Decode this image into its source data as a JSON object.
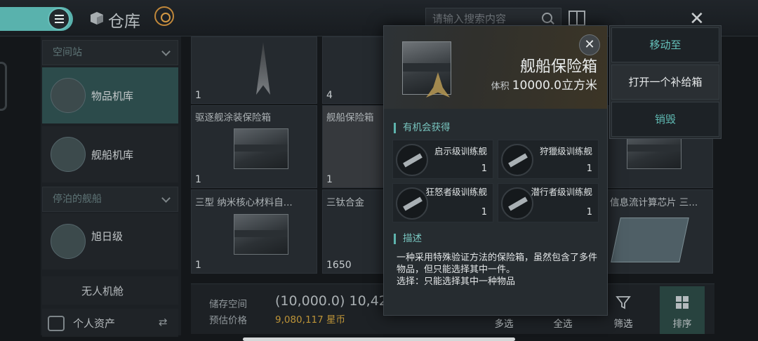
{
  "header": {
    "title": "仓库",
    "search_placeholder": "请输入搜索内容"
  },
  "sidebar": {
    "station_dropdown": "空间站",
    "items": [
      {
        "label": "物品机库"
      },
      {
        "label": "舰船机库"
      }
    ],
    "docked_dropdown": "停泊的舰船",
    "ship": {
      "label": "旭日级"
    },
    "drone_bay": "无人机舱",
    "personal_assets": "个人资产"
  },
  "grid": {
    "cells": [
      {
        "count": "1"
      },
      {
        "count": "4"
      },
      {
        "name": "驱逐舰涂装保险箱",
        "count": "1"
      },
      {
        "name": "舰船保险箱",
        "count": "1"
      },
      {
        "count": ""
      },
      {
        "name": "信息流计算芯片 三...",
        "count": ""
      },
      {
        "name": "三型 纳米核心材料自...",
        "count": "1"
      },
      {
        "name": "三钛合金",
        "count": "1650"
      }
    ]
  },
  "footer": {
    "storage_label": "储存空间",
    "storage_value": "(10,000.0) 10,42",
    "price_label": "预估价格",
    "price_value": "9,080,117 星币",
    "actions": [
      "多选",
      "全选",
      "筛选",
      "排序"
    ]
  },
  "popup": {
    "title": "舰船保险箱",
    "volume_label": "体积",
    "volume_value": "10000.0立方米",
    "chance_section": "有机会获得",
    "loot": [
      {
        "name": "启示级训练舰",
        "qty": "1"
      },
      {
        "name": "狩獵级训练舰",
        "qty": "1"
      },
      {
        "name": "狂怒者级训练舰",
        "qty": "1"
      },
      {
        "name": "潜行者级训练舰",
        "qty": "1"
      }
    ],
    "desc_section": "描述",
    "desc_line1": "一种采用特殊验证方法的保险箱，虽然包含了多件物品，但只能选择其中一件。",
    "desc_line2": "选择：只能选择其中一种物品"
  },
  "context_menu": [
    "移动至",
    "打开一个补给箱",
    "销毁"
  ],
  "colors": {
    "accent": "#59b2ad",
    "gold": "#bd9438",
    "panel": "#262c30"
  }
}
